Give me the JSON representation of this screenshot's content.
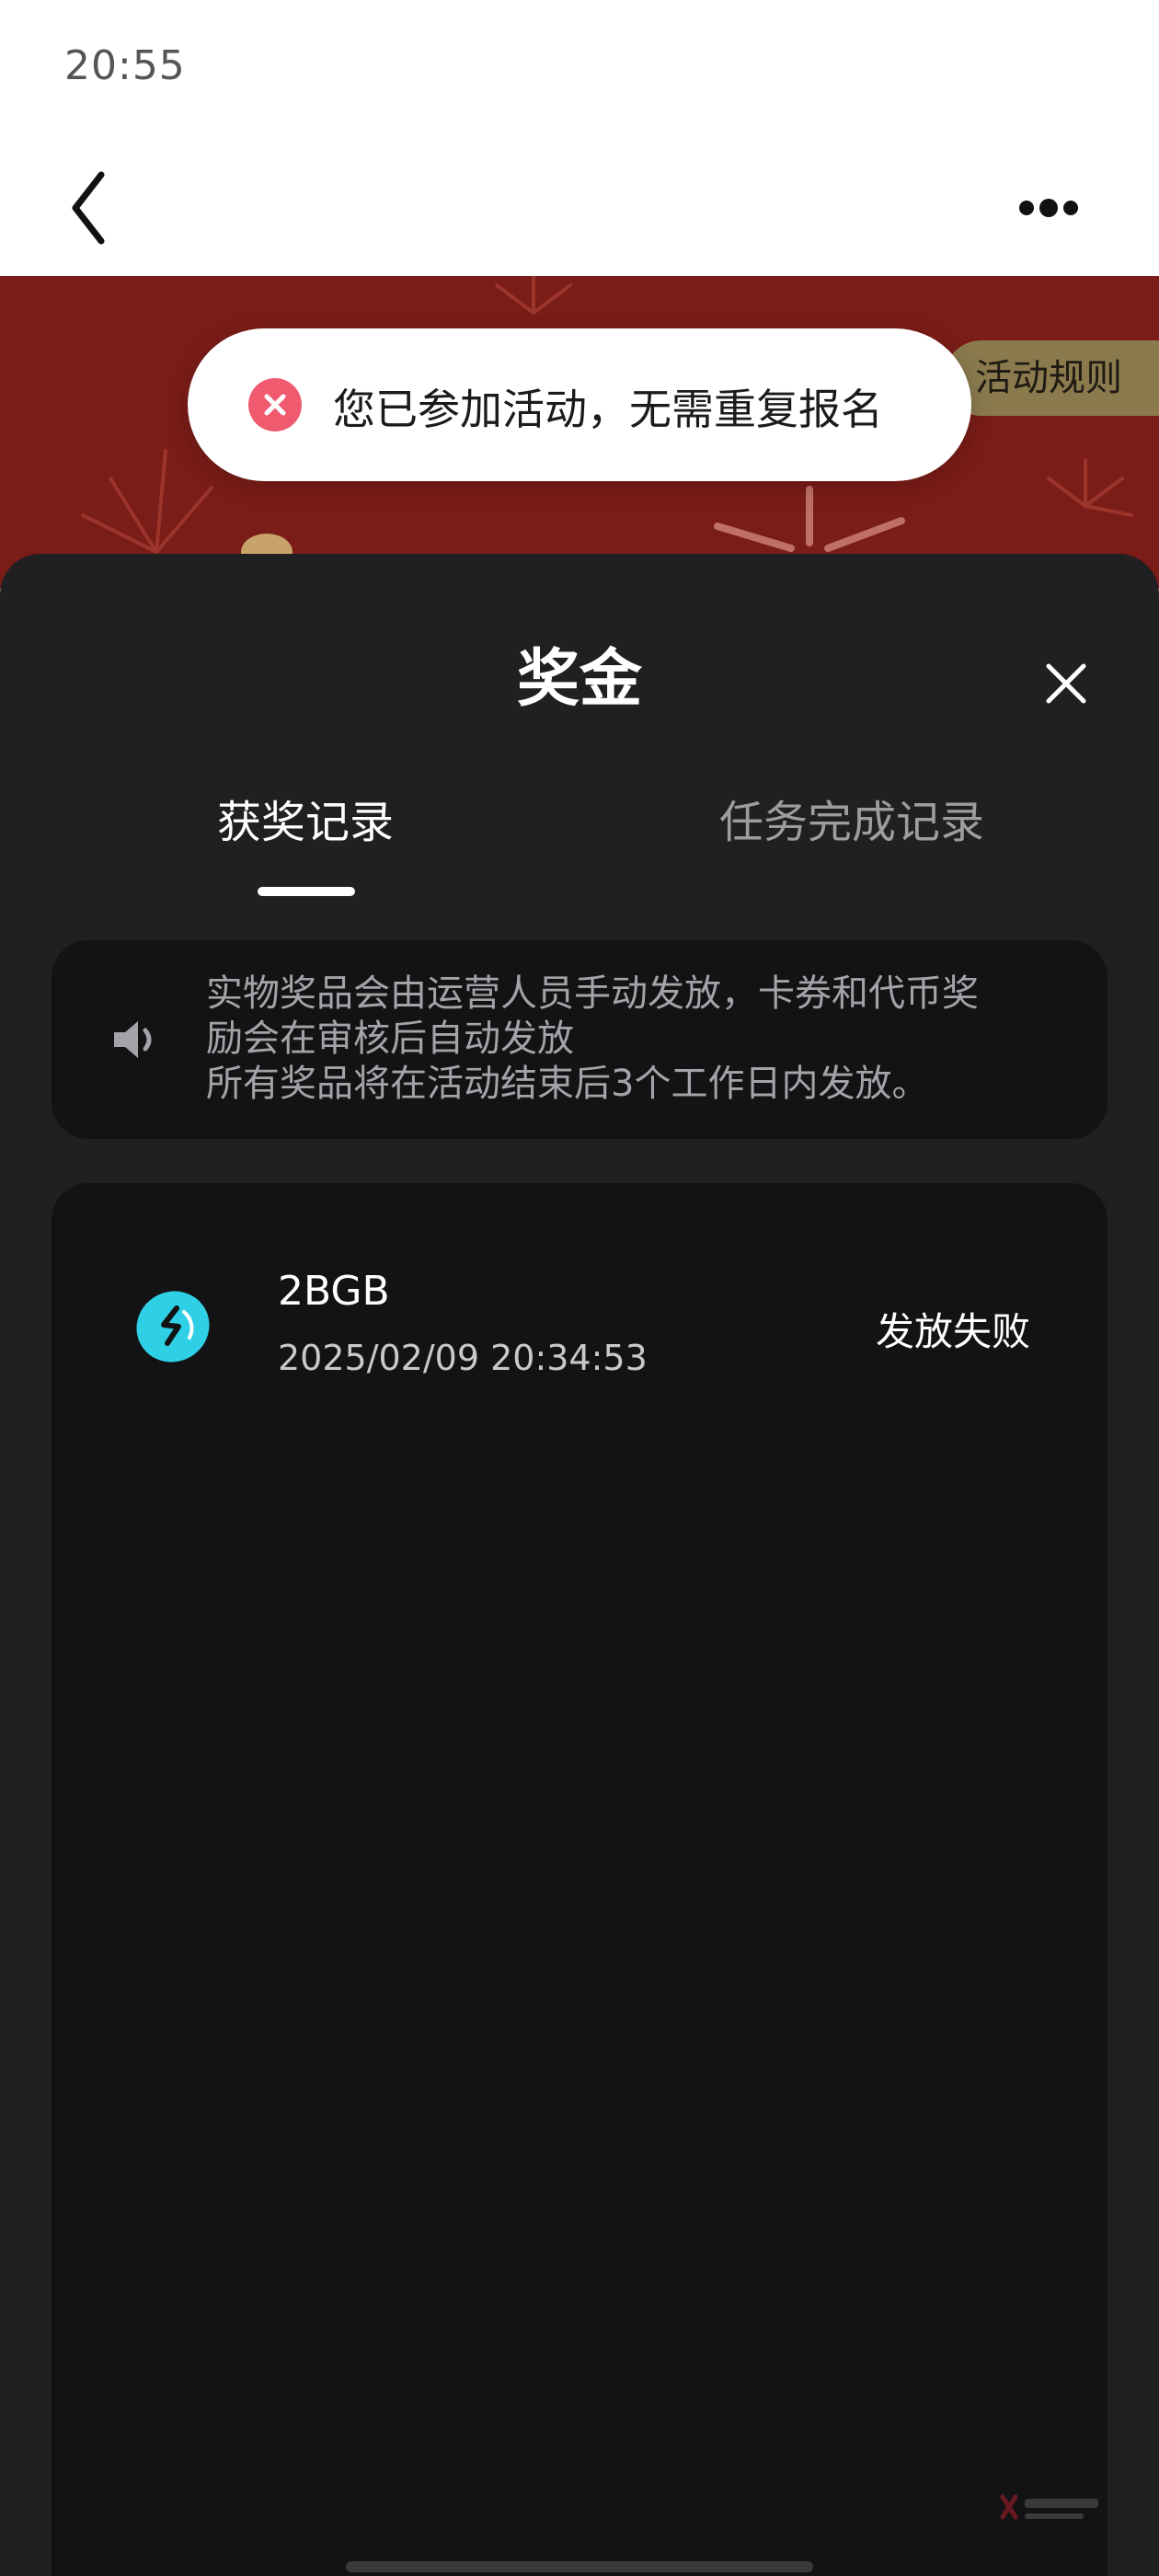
{
  "status_bar": {
    "time": "20:55"
  },
  "banner": {
    "rules_label": "活动规则"
  },
  "toast": {
    "message": "您已参加活动，无需重复报名"
  },
  "sheet": {
    "title": "奖金",
    "tabs": [
      {
        "label": "获奖记录",
        "active": true
      },
      {
        "label": "任务完成记录",
        "active": false
      }
    ],
    "notice": {
      "lines": [
        "实物奖品会由运营人员手动发放，卡券和代币奖",
        "励会在审核后自动发放",
        "所有奖品将在活动结束后3个工作日内发放。"
      ]
    },
    "records": [
      {
        "name": "2BGB",
        "time": "2025/02/09 20:34:53",
        "status": "发放失败"
      }
    ]
  },
  "colors": {
    "banner_red": "#7a1c17",
    "sheet_bg": "#202022",
    "card_bg": "#131315",
    "toast_icon": "#ef5a6f",
    "coin": "#2fd0e6",
    "rules_tag": "#8a7a4e"
  },
  "icons": [
    "back-icon",
    "more-icon",
    "error-icon",
    "close-icon",
    "speaker-icon",
    "coin-icon"
  ]
}
